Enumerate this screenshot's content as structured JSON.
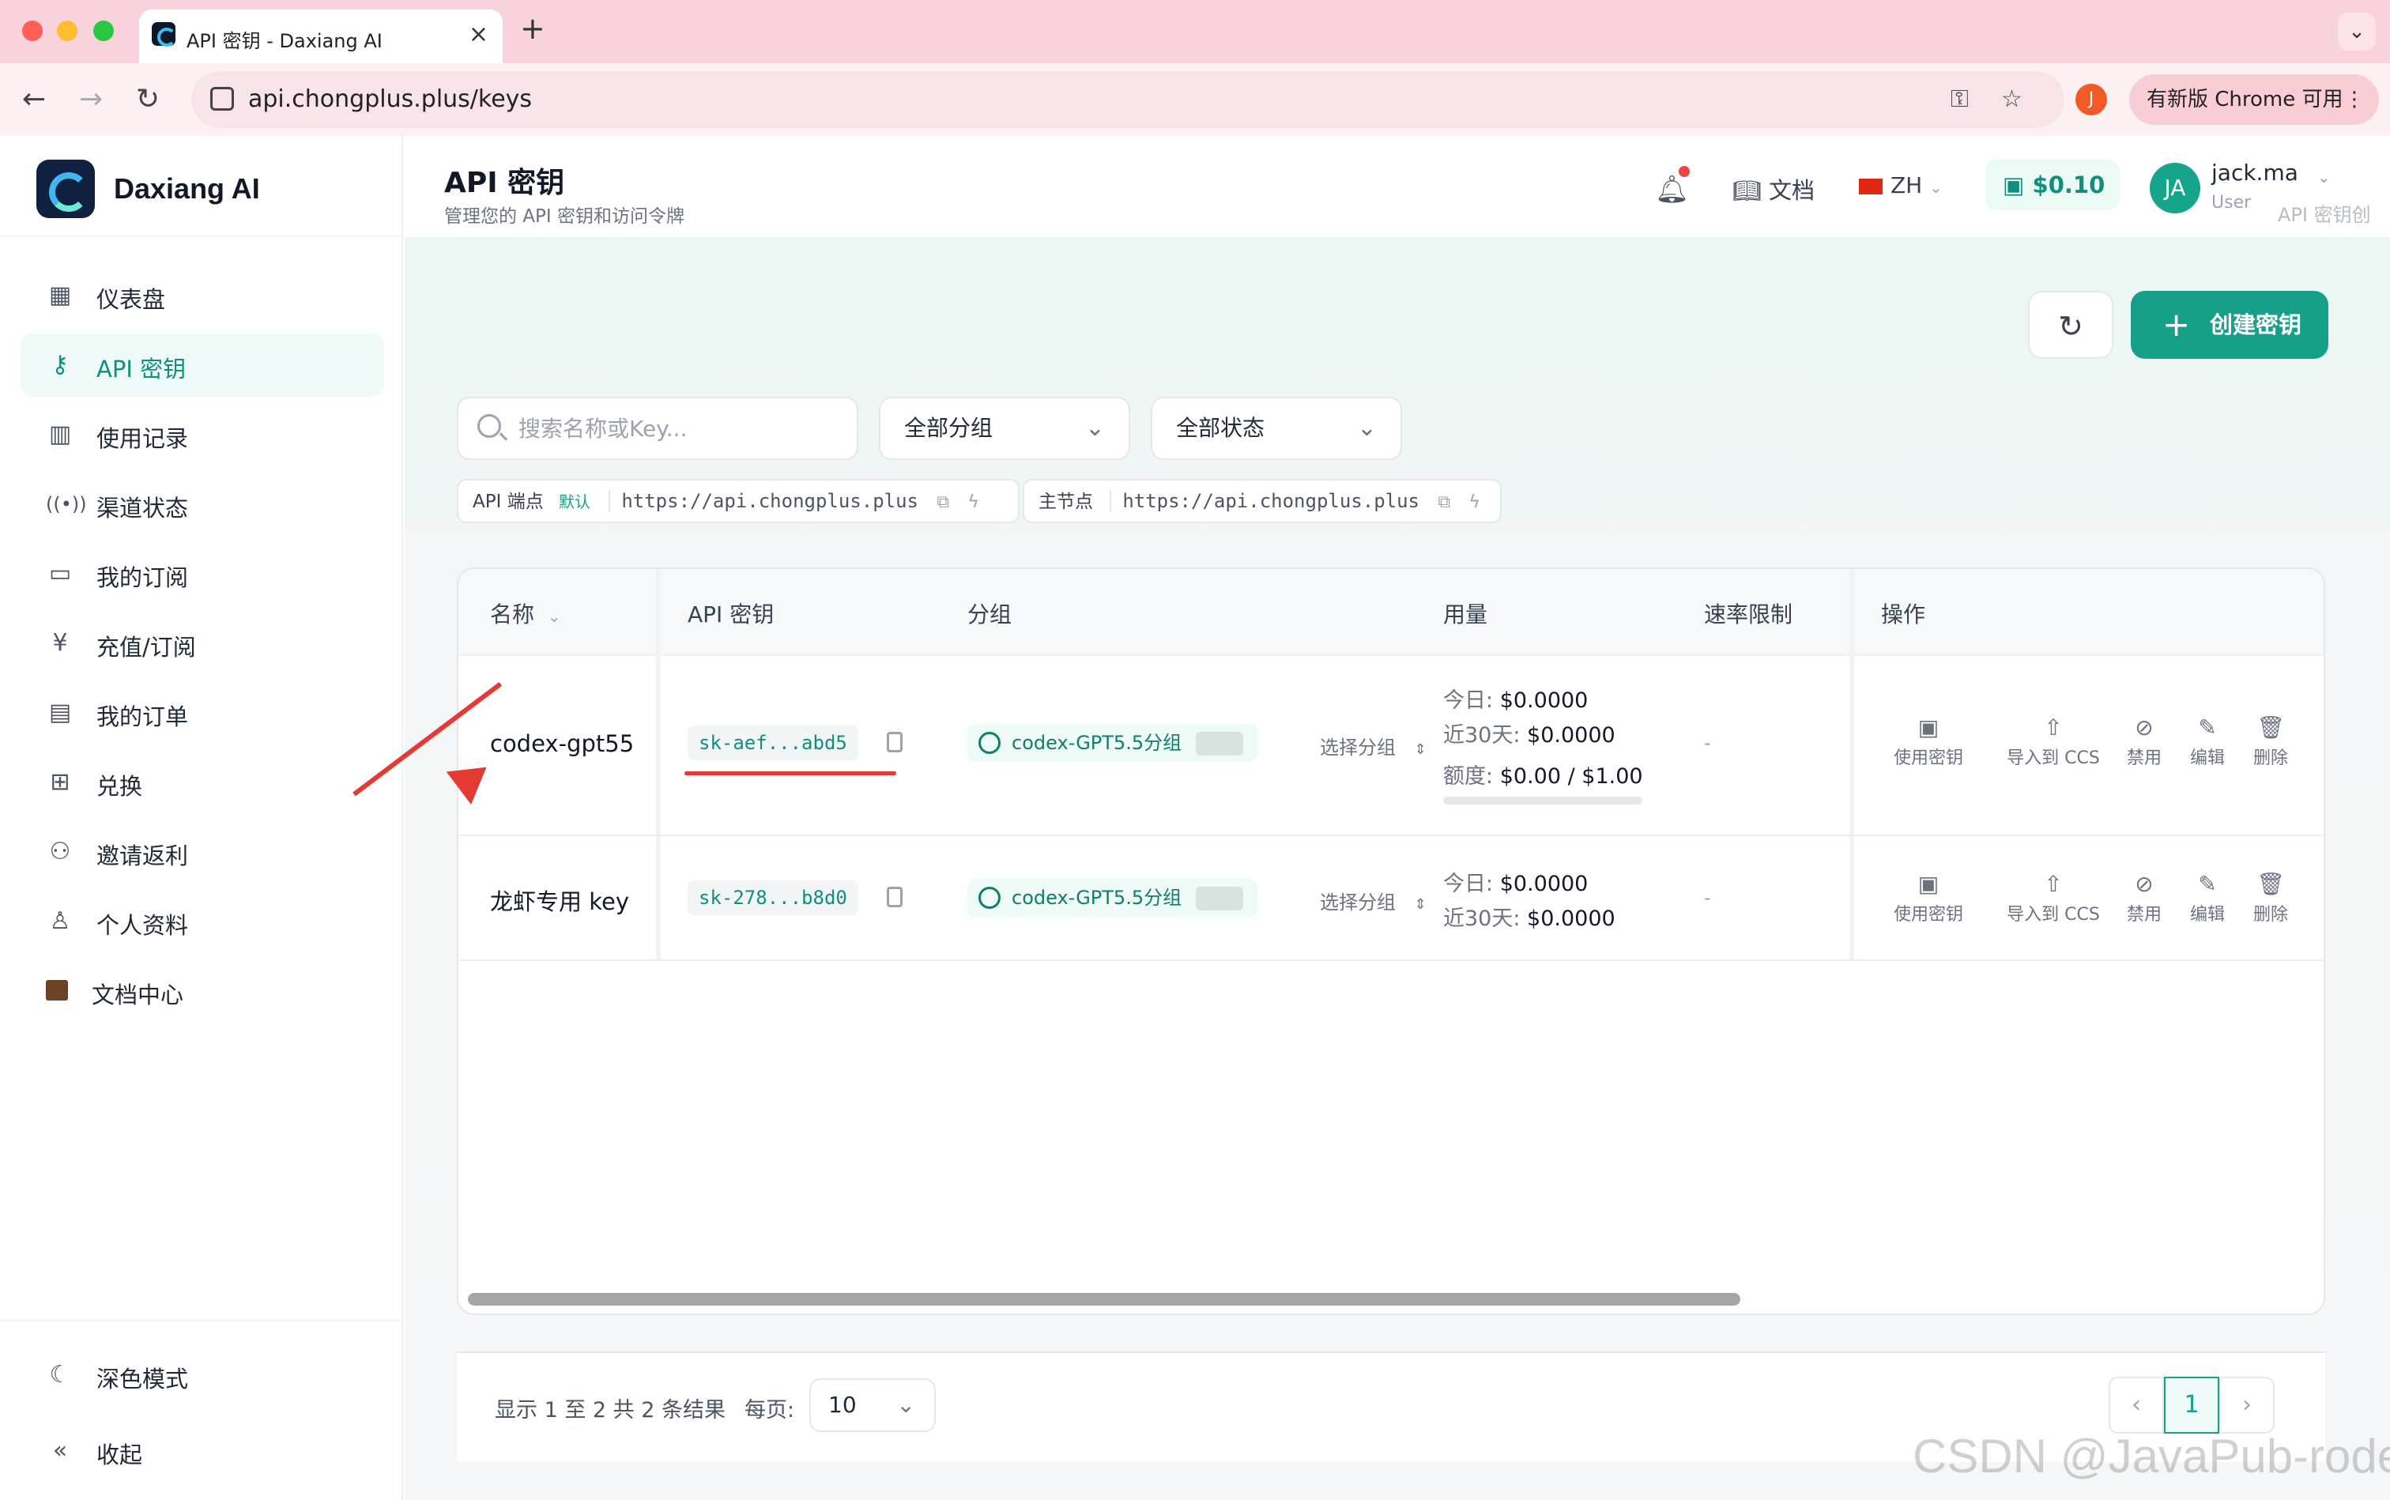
{
  "browser": {
    "tab_title": "API 密钥 - Daxiang AI",
    "url": "api.chongplus.plus/keys",
    "profile_initial": "J",
    "chrome_update": "有新版 Chrome 可用"
  },
  "sidebar": {
    "brand": "Daxiang AI",
    "items": [
      {
        "label": "仪表盘",
        "icon": "dashboard-icon"
      },
      {
        "label": "API 密钥",
        "icon": "key-icon",
        "active": true
      },
      {
        "label": "使用记录",
        "icon": "bar-chart-icon"
      },
      {
        "label": "渠道状态",
        "icon": "signal-icon"
      },
      {
        "label": "我的订阅",
        "icon": "card-icon"
      },
      {
        "label": "充值/订阅",
        "icon": "yen-icon"
      },
      {
        "label": "我的订单",
        "icon": "document-icon"
      },
      {
        "label": "兑换",
        "icon": "gift-icon"
      },
      {
        "label": "邀请返利",
        "icon": "users-icon"
      },
      {
        "label": "个人资料",
        "icon": "user-icon"
      },
      {
        "label": "文档中心",
        "icon": "books-icon"
      }
    ],
    "dark_mode": "深色模式",
    "collapse": "收起"
  },
  "header": {
    "title": "API 密钥",
    "subtitle": "管理您的 API 密钥和访问令牌",
    "docs": "文档",
    "lang": "ZH",
    "balance": "$0.10",
    "avatar": "JA",
    "user_name": "jack.ma",
    "user_role": "User",
    "ghost_text": "API 密钥创"
  },
  "toolbar": {
    "create_label": "创建密钥",
    "search_placeholder": "搜索名称或Key...",
    "group_filter": "全部分组",
    "status_filter": "全部状态"
  },
  "endpoints": [
    {
      "label": "API 端点",
      "tag": "默认",
      "url": "https://api.chongplus.plus"
    },
    {
      "label": "主节点",
      "tag": "",
      "url": "https://api.chongplus.plus"
    }
  ],
  "table": {
    "columns": [
      "名称",
      "API 密钥",
      "分组",
      "用量",
      "速率限制",
      "操作"
    ],
    "rows": [
      {
        "name": "codex-gpt55",
        "key": "sk-aef...abd5",
        "group": "codex-GPT5.5分组",
        "select_group": "选择分组",
        "usage_today_label": "今日:",
        "usage_today": "$0.0000",
        "usage_30d_label": "近30天:",
        "usage_30d": "$0.0000",
        "quota_label": "额度:",
        "quota": "$0.00 / $1.00",
        "quota_fraction": 0,
        "rate_limit": "-"
      },
      {
        "name": "龙虾专用 key",
        "key": "sk-278...b8d0",
        "group": "codex-GPT5.5分组",
        "select_group": "选择分组",
        "usage_today_label": "今日:",
        "usage_today": "$0.0000",
        "usage_30d_label": "近30天:",
        "usage_30d": "$0.0000",
        "rate_limit": "-"
      }
    ],
    "actions": [
      "使用密钥",
      "导入到 CCS",
      "禁用",
      "编辑",
      "删除"
    ]
  },
  "pagination": {
    "summary": "显示 1 至 2 共 2 条结果",
    "per_page_label": "每页:",
    "per_page": "10",
    "current_page": "1"
  },
  "watermark": "CSDN @JavaPub-rodert",
  "colors": {
    "accent": "#16a08a",
    "annotation": "#e53935"
  }
}
